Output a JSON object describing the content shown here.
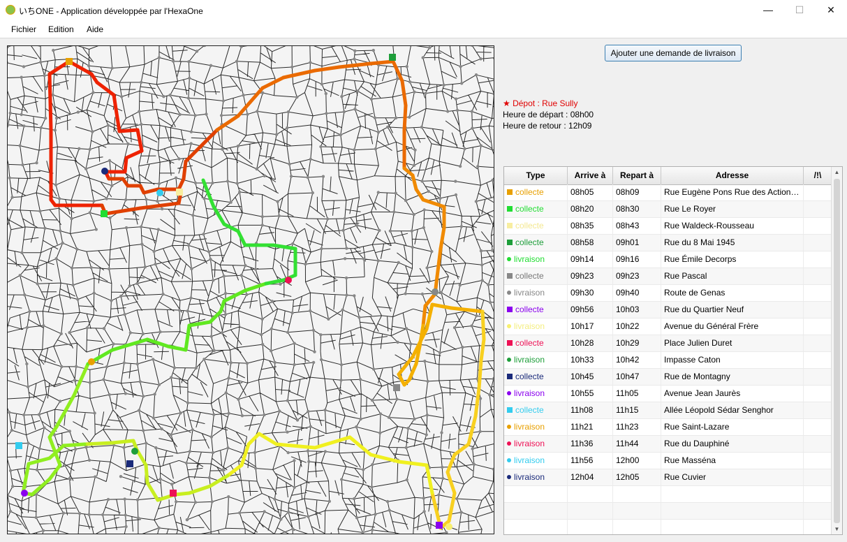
{
  "window": {
    "title": "いちONE - Application développée par l'HexaOne",
    "minimize": "—",
    "maximize": "☐",
    "close": "✕"
  },
  "menu": [
    "Fichier",
    "Edition",
    "Aide"
  ],
  "actions": {
    "add_request": "Ajouter une demande de livraison"
  },
  "depot": {
    "label": "★ Dépot : Rue Sully",
    "departure": "Heure de départ : 08h00",
    "return": "Heure de retour : 12h09",
    "color": "#e00000"
  },
  "table": {
    "headers": [
      "Type",
      "Arrive à",
      "Repart à",
      "Adresse",
      "/!\\"
    ],
    "rows": [
      {
        "type": "collecte",
        "shape": "square",
        "color": "#e8a000",
        "text_color": "#e8a000",
        "arrive": "08h05",
        "depart": "08h09",
        "address": "Rue Eugène Pons Rue des Actionnaires"
      },
      {
        "type": "collecte",
        "shape": "square",
        "color": "#22dd33",
        "text_color": "#22dd33",
        "arrive": "08h20",
        "depart": "08h30",
        "address": "Rue Le Royer"
      },
      {
        "type": "collecte",
        "shape": "square",
        "color": "#f8eea0",
        "text_color": "#f4e890",
        "arrive": "08h35",
        "depart": "08h43",
        "address": "Rue Waldeck-Rousseau"
      },
      {
        "type": "collecte",
        "shape": "square",
        "color": "#1e9e3a",
        "text_color": "#1e9e3a",
        "arrive": "08h58",
        "depart": "09h01",
        "address": "Rue du 8 Mai 1945"
      },
      {
        "type": "livraison",
        "shape": "round",
        "color": "#22dd33",
        "text_color": "#22dd33",
        "arrive": "09h14",
        "depart": "09h16",
        "address": "Rue Émile Decorps"
      },
      {
        "type": "collecte",
        "shape": "square",
        "color": "#888888",
        "text_color": "#777777",
        "arrive": "09h23",
        "depart": "09h23",
        "address": "Rue Pascal"
      },
      {
        "type": "livraison",
        "shape": "round",
        "color": "#888888",
        "text_color": "#888888",
        "arrive": "09h30",
        "depart": "09h40",
        "address": "Route de Genas"
      },
      {
        "type": "collecte",
        "shape": "square",
        "color": "#8a00ee",
        "text_color": "#8a00ee",
        "arrive": "09h56",
        "depart": "10h03",
        "address": "Rue du Quartier Neuf"
      },
      {
        "type": "livraison",
        "shape": "round",
        "color": "#f8f070",
        "text_color": "#f4ee80",
        "arrive": "10h17",
        "depart": "10h22",
        "address": "Avenue du Général Frère"
      },
      {
        "type": "collecte",
        "shape": "square",
        "color": "#ee1155",
        "text_color": "#ee1155",
        "arrive": "10h28",
        "depart": "10h29",
        "address": "Place Julien Duret"
      },
      {
        "type": "livraison",
        "shape": "round",
        "color": "#1e9e3a",
        "text_color": "#1e9e3a",
        "arrive": "10h33",
        "depart": "10h42",
        "address": "Impasse Caton"
      },
      {
        "type": "collecte",
        "shape": "square",
        "color": "#1a2a7a",
        "text_color": "#1a2a7a",
        "arrive": "10h45",
        "depart": "10h47",
        "address": "Rue de Montagny"
      },
      {
        "type": "livraison",
        "shape": "round",
        "color": "#8a00ee",
        "text_color": "#8a00ee",
        "arrive": "10h55",
        "depart": "11h05",
        "address": "Avenue Jean Jaurès"
      },
      {
        "type": "collecte",
        "shape": "square",
        "color": "#33ccee",
        "text_color": "#33ccee",
        "arrive": "11h08",
        "depart": "11h15",
        "address": "Allée Léopold Sédar Senghor"
      },
      {
        "type": "livraison",
        "shape": "round",
        "color": "#e8a000",
        "text_color": "#e8a000",
        "arrive": "11h21",
        "depart": "11h23",
        "address": "Rue Saint-Lazare"
      },
      {
        "type": "livraison",
        "shape": "round",
        "color": "#ee1155",
        "text_color": "#ee1155",
        "arrive": "11h36",
        "depart": "11h44",
        "address": "Rue du Dauphiné"
      },
      {
        "type": "livraison",
        "shape": "round",
        "color": "#33ccee",
        "text_color": "#33ccee",
        "arrive": "11h56",
        "depart": "12h00",
        "address": "Rue Masséna"
      },
      {
        "type": "livraison",
        "shape": "round",
        "color": "#1a2a7a",
        "text_color": "#1a2a7a",
        "arrive": "12h04",
        "depart": "12h05",
        "address": "Rue Cuvier"
      }
    ]
  },
  "map": {
    "route_colors": [
      "#ee2200",
      "#e04000",
      "#ea6a00",
      "#f08a00",
      "#f4b000",
      "#f8d020",
      "#f0f020",
      "#c8ee20",
      "#90ee20",
      "#60e820",
      "#33e033"
    ]
  }
}
